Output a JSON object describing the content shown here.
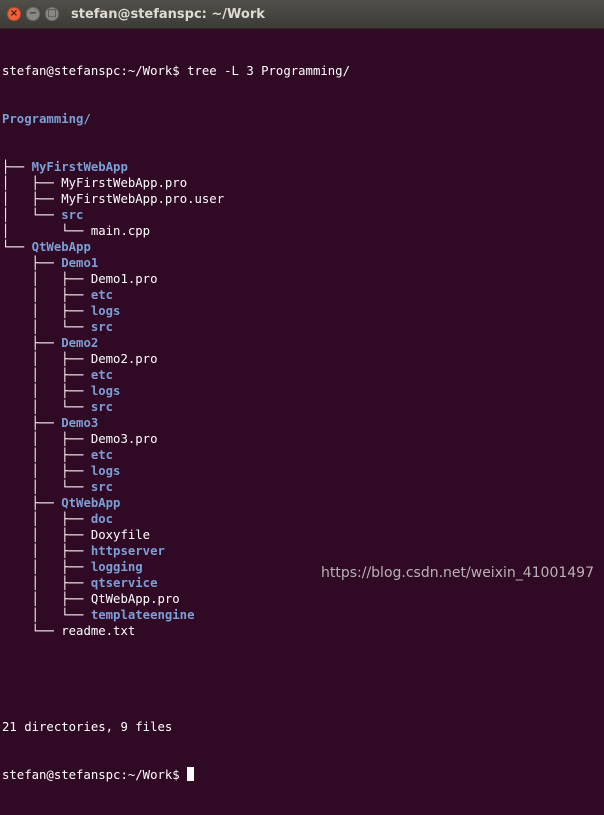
{
  "window": {
    "title": "stefan@stefanspc: ~/Work",
    "buttons": {
      "close": "×",
      "minimize": "−",
      "maximize": "□"
    }
  },
  "terminal": {
    "command_prompt": "stefan@stefanspc:~/Work$ ",
    "command": "tree -L 3 Programming/",
    "root": "Programming/",
    "tree": [
      {
        "prefix": "├── ",
        "name": "MyFirstWebApp",
        "type": "dir"
      },
      {
        "prefix": "│   ├── ",
        "name": "MyFirstWebApp.pro",
        "type": "file"
      },
      {
        "prefix": "│   ├── ",
        "name": "MyFirstWebApp.pro.user",
        "type": "file"
      },
      {
        "prefix": "│   └── ",
        "name": "src",
        "type": "dir"
      },
      {
        "prefix": "│       └── ",
        "name": "main.cpp",
        "type": "file"
      },
      {
        "prefix": "└── ",
        "name": "QtWebApp",
        "type": "dir"
      },
      {
        "prefix": "    ├── ",
        "name": "Demo1",
        "type": "dir"
      },
      {
        "prefix": "    │   ├── ",
        "name": "Demo1.pro",
        "type": "file"
      },
      {
        "prefix": "    │   ├── ",
        "name": "etc",
        "type": "dir"
      },
      {
        "prefix": "    │   ├── ",
        "name": "logs",
        "type": "dir"
      },
      {
        "prefix": "    │   └── ",
        "name": "src",
        "type": "dir"
      },
      {
        "prefix": "    ├── ",
        "name": "Demo2",
        "type": "dir"
      },
      {
        "prefix": "    │   ├── ",
        "name": "Demo2.pro",
        "type": "file"
      },
      {
        "prefix": "    │   ├── ",
        "name": "etc",
        "type": "dir"
      },
      {
        "prefix": "    │   ├── ",
        "name": "logs",
        "type": "dir"
      },
      {
        "prefix": "    │   └── ",
        "name": "src",
        "type": "dir"
      },
      {
        "prefix": "    ├── ",
        "name": "Demo3",
        "type": "dir"
      },
      {
        "prefix": "    │   ├── ",
        "name": "Demo3.pro",
        "type": "file"
      },
      {
        "prefix": "    │   ├── ",
        "name": "etc",
        "type": "dir"
      },
      {
        "prefix": "    │   ├── ",
        "name": "logs",
        "type": "dir"
      },
      {
        "prefix": "    │   └── ",
        "name": "src",
        "type": "dir"
      },
      {
        "prefix": "    ├── ",
        "name": "QtWebApp",
        "type": "dir"
      },
      {
        "prefix": "    │   ├── ",
        "name": "doc",
        "type": "dir"
      },
      {
        "prefix": "    │   ├── ",
        "name": "Doxyfile",
        "type": "file"
      },
      {
        "prefix": "    │   ├── ",
        "name": "httpserver",
        "type": "dir"
      },
      {
        "prefix": "    │   ├── ",
        "name": "logging",
        "type": "dir"
      },
      {
        "prefix": "    │   ├── ",
        "name": "qtservice",
        "type": "dir"
      },
      {
        "prefix": "    │   ├── ",
        "name": "QtWebApp.pro",
        "type": "file"
      },
      {
        "prefix": "    │   └── ",
        "name": "templateengine",
        "type": "dir"
      },
      {
        "prefix": "    └── ",
        "name": "readme.txt",
        "type": "file"
      }
    ],
    "summary": "21 directories, 9 files",
    "final_prompt": "stefan@stefanspc:~/Work$ "
  },
  "watermark": "https://blog.csdn.net/weixin_41001497",
  "colors": {
    "background": "#300a24",
    "directory": "#7b9fd6",
    "text": "#ffffff",
    "close_button": "#f0603c"
  }
}
